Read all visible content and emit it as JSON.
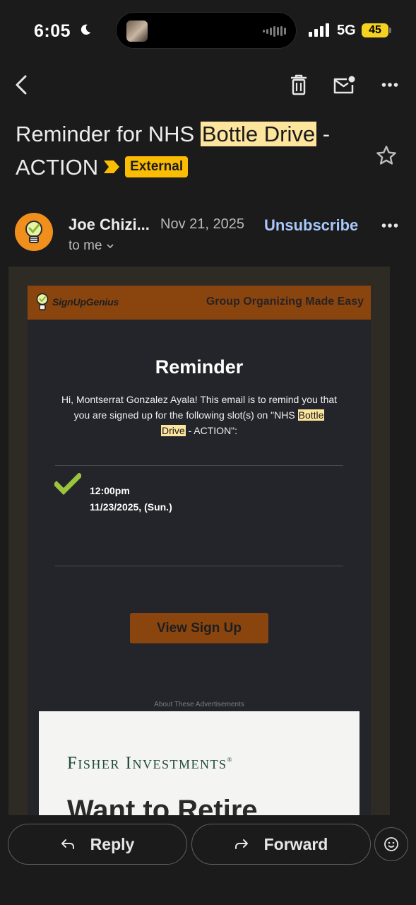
{
  "status_bar": {
    "time": "6:05",
    "network": "5G",
    "battery": "45"
  },
  "toolbar": {
    "back_icon": "chevron-left-icon",
    "delete_icon": "trash-icon",
    "mark_unread_icon": "mail-unread-icon",
    "more_icon": "more-horizontal-icon"
  },
  "email": {
    "subject_pre": "Reminder for NHS ",
    "subject_highlight": "Bottle Drive",
    "subject_post": " - ACTION",
    "external_label": "External",
    "sender": "Joe Chizi...",
    "date": "Nov 21, 2025",
    "recipient": "to me",
    "unsubscribe": "Unsubscribe"
  },
  "body": {
    "brand": "SignUpGenius",
    "tagline": "Group Organizing Made Easy",
    "title": "Reminder",
    "message_pre": "Hi, Montserrat Gonzalez Ayala! This email is to remind you that you are signed up for the following slot(s) on \"NHS ",
    "message_hl1": "Bottle",
    "message_space": " ",
    "message_hl2": "Drive",
    "message_post": " - ACTION\":",
    "slot_time": "12:00pm",
    "slot_date": "11/23/2025, (Sun.)",
    "view_button": "View Sign Up",
    "ads_note": "About These Advertisements",
    "ad_brand": "Fisher Investments",
    "ad_headline": "Want to Retire"
  },
  "actions": {
    "reply": "Reply",
    "forward": "Forward",
    "emoji_icon": "emoji-icon"
  },
  "colors": {
    "highlight": "#fde59e",
    "external_badge": "#fbbc04",
    "unsubscribe": "#a8c7fa",
    "signupgenius_brand": "#8a450f",
    "check": "#9bc53d"
  }
}
